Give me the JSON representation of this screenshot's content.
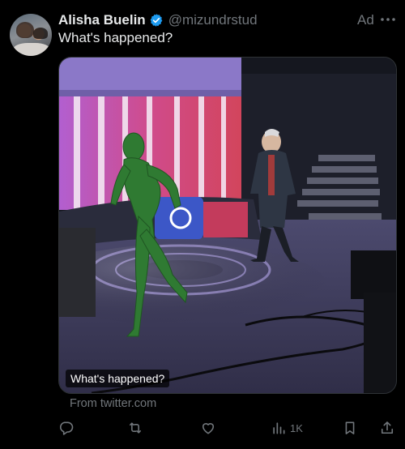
{
  "author": {
    "display_name": "Alisha Buelin",
    "handle": "@mizundrstud",
    "verified": true
  },
  "ad_label": "Ad",
  "tweet": {
    "text": "What's happened?"
  },
  "media": {
    "caption": "What's happened?",
    "source": "From twitter.com"
  },
  "actions": {
    "reply": {
      "icon": "reply-icon"
    },
    "retweet": {
      "icon": "retweet-icon"
    },
    "like": {
      "icon": "heart-icon"
    },
    "views": {
      "icon": "views-icon",
      "count": "1K"
    },
    "bookmark": {
      "icon": "bookmark-icon"
    },
    "share": {
      "icon": "share-icon"
    }
  },
  "colors": {
    "background": "#000000",
    "text": "#e7e9ea",
    "secondary": "#71767b",
    "verified": "#1d9bf0"
  }
}
